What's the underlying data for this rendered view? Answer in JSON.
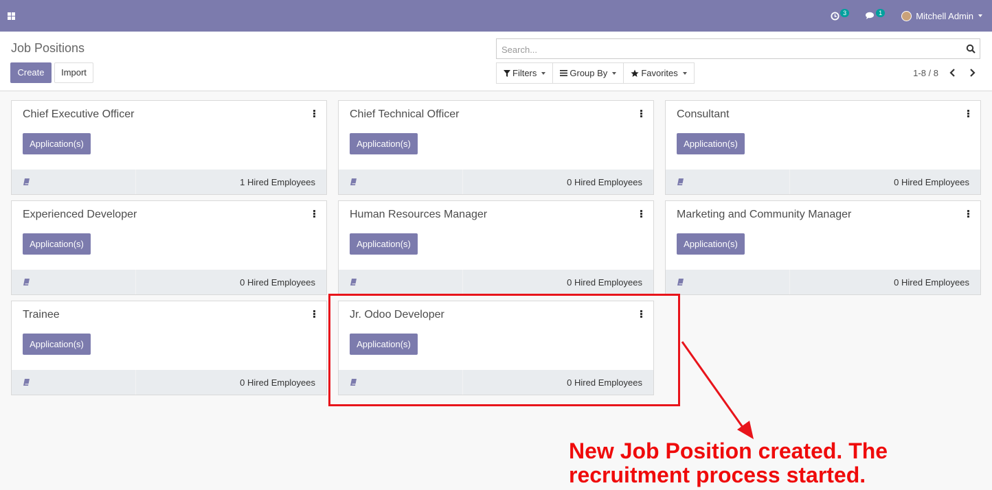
{
  "navbar": {
    "activity_count": "3",
    "message_count": "1",
    "user_name": "Mitchell Admin"
  },
  "control_panel": {
    "title": "Job Positions",
    "create_label": "Create",
    "import_label": "Import",
    "search_placeholder": "Search...",
    "filters_label": "Filters",
    "groupby_label": "Group By",
    "favorites_label": "Favorites",
    "pager": "1-8 / 8"
  },
  "cards": [
    {
      "title": "Chief Executive Officer",
      "button": "Application(s)",
      "hired": "1 Hired Employees"
    },
    {
      "title": "Chief Technical Officer",
      "button": "Application(s)",
      "hired": "0 Hired Employees"
    },
    {
      "title": "Consultant",
      "button": "Application(s)",
      "hired": "0 Hired Employees"
    },
    {
      "title": "Experienced Developer",
      "button": "Application(s)",
      "hired": "0 Hired Employees"
    },
    {
      "title": "Human Resources Manager",
      "button": "Application(s)",
      "hired": "0 Hired Employees"
    },
    {
      "title": "Marketing and Community Manager",
      "button": "Application(s)",
      "hired": "0 Hired Employees"
    },
    {
      "title": "Trainee",
      "button": "Application(s)",
      "hired": "0 Hired Employees"
    },
    {
      "title": "Jr. Odoo Developer",
      "button": "Application(s)",
      "hired": "0 Hired Employees"
    }
  ],
  "annotation": {
    "line1": "New Job Position created. The",
    "line2": "recruitment process started."
  },
  "colors": {
    "brand": "#7c7bad",
    "badge": "#00a09d",
    "annotation": "#ef0b0b"
  }
}
